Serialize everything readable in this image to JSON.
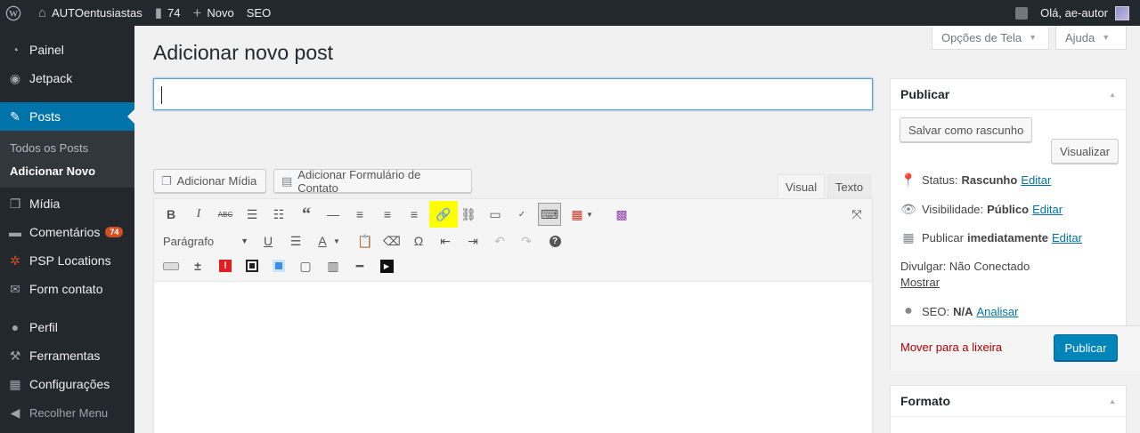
{
  "adminbar": {
    "wp_logo": "wordpress-icon",
    "site_name": "AUTOentusiastas",
    "comments_count": "74",
    "new_label": "Novo",
    "seo_label": "SEO",
    "greeting": "Olá, ae-autor"
  },
  "sidebar": {
    "items": [
      {
        "label": "Painel",
        "icon": "dashboard-icon"
      },
      {
        "label": "Jetpack",
        "icon": "jetpack-icon"
      },
      {
        "label": "Posts",
        "icon": "pin-icon"
      },
      {
        "label": "Mídia",
        "icon": "media-icon"
      },
      {
        "label": "Comentários",
        "icon": "comment-icon",
        "badge": "74"
      },
      {
        "label": "PSP Locations",
        "icon": "location-icon"
      },
      {
        "label": "Form contato",
        "icon": "mail-icon"
      },
      {
        "label": "Perfil",
        "icon": "user-icon"
      },
      {
        "label": "Ferramentas",
        "icon": "wrench-icon"
      },
      {
        "label": "Configurações",
        "icon": "settings-icon"
      },
      {
        "label": "Recolher Menu",
        "icon": "collapse-icon"
      }
    ],
    "posts_sub": [
      "Todos os Posts",
      "Adicionar Novo"
    ]
  },
  "screen": {
    "options_label": "Opções de Tela",
    "help_label": "Ajuda"
  },
  "main": {
    "title": "Adicionar novo post",
    "title_value": "",
    "add_media": "Adicionar Mídia",
    "add_form": "Adicionar Formulário de Contato",
    "tab_visual": "Visual",
    "tab_text": "Texto",
    "format_select": "Parágrafo"
  },
  "publish": {
    "header": "Publicar",
    "save_draft": "Salvar como rascunho",
    "preview": "Visualizar",
    "status_label": "Status:",
    "status_value": "Rascunho",
    "visibility_label": "Visibilidade:",
    "visibility_value": "Público",
    "publish_label": "Publicar",
    "publish_value": "imediatamente",
    "edit_link": "Editar",
    "share_label": "Divulgar: Não Conectado",
    "show_link": "Mostrar",
    "seo_label": "SEO:",
    "seo_value": "N/A",
    "analyze_link": "Analisar",
    "trash": "Mover para a lixeira",
    "publish_button": "Publicar"
  },
  "format_box": {
    "header": "Formato"
  },
  "colors": {
    "adminbar": "#23282d",
    "accent": "#0073aa",
    "highlight": "#ffff00",
    "publish": "#0085ba",
    "trash": "#aa0000"
  }
}
